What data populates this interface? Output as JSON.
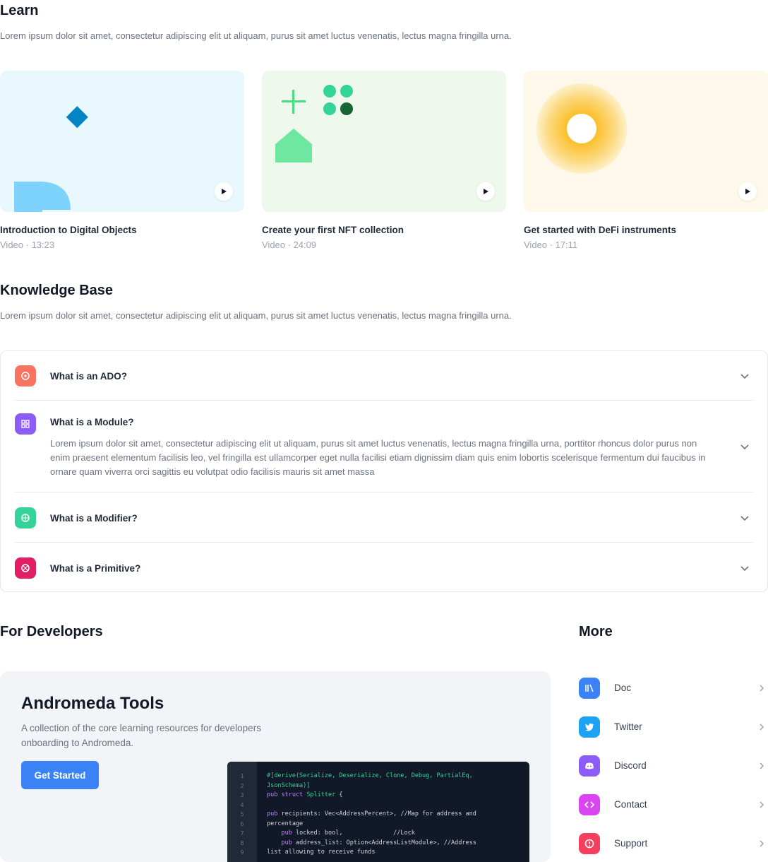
{
  "learn": {
    "title": "Learn",
    "description": "Lorem ipsum dolor sit amet, consectetur adipiscing elit ut aliquam, purus sit amet luctus venenatis, lectus magna fringilla urna.",
    "cards": [
      {
        "title": "Introduction to Digital Objects",
        "meta": "Video · 13:23",
        "bg": "#e8f8fd"
      },
      {
        "title": "Create your first NFT collection",
        "meta": "Video · 24:09",
        "bg": "#eef8ec"
      },
      {
        "title": "Get started with DeFi instruments",
        "meta": "Video · 17:11",
        "bg": "#fdf8ea"
      }
    ]
  },
  "knowledge_base": {
    "title": "Knowledge Base",
    "description": "Lorem ipsum dolor sit amet, consectetur adipiscing elit ut aliquam, purus sit amet luctus venenatis, lectus magna fringilla urna.",
    "items": [
      {
        "question": "What is an ADO?",
        "icon": "ado-icon",
        "color": "#f97362"
      },
      {
        "question": "What is a Module?",
        "icon": "module-icon",
        "color": "#8b5cf6",
        "answer": "Lorem ipsum dolor sit amet, consectetur adipiscing elit ut aliquam, purus sit amet luctus venenatis, lectus magna fringilla urna, porttitor rhoncus dolor purus non enim praesent elementum facilisis leo, vel fringilla est ullamcorper eget nulla facilisi etiam dignissim diam quis enim lobortis scelerisque fermentum dui faucibus in ornare quam viverra orci sagittis eu volutpat odio facilisis mauris sit amet massa"
      },
      {
        "question": "What is a Modifier?",
        "icon": "modifier-icon",
        "color": "#34d399"
      },
      {
        "question": "What is a Primitive?",
        "icon": "primitive-icon",
        "color": "#e11d63"
      }
    ]
  },
  "developers": {
    "title": "For Developers",
    "card_title": "Andromeda Tools",
    "card_description": "A collection of the core learning resources for developers onboarding to Andromeda.",
    "button_label": "Get Started",
    "code_lines": [
      "1",
      "2",
      "3",
      "4",
      "5",
      "6",
      "7",
      "8",
      "9"
    ]
  },
  "more": {
    "title": "More",
    "items": [
      {
        "label": "Doc",
        "icon": "doc-icon",
        "color": "#3b82f6"
      },
      {
        "label": "Twitter",
        "icon": "twitter-icon",
        "color": "#1da1f2"
      },
      {
        "label": "Discord",
        "icon": "discord-icon",
        "color": "#8b5cf6"
      },
      {
        "label": "Contact",
        "icon": "code-icon",
        "color": "#d946ef"
      },
      {
        "label": "Support",
        "icon": "support-icon",
        "color": "#f43f5e"
      }
    ]
  }
}
